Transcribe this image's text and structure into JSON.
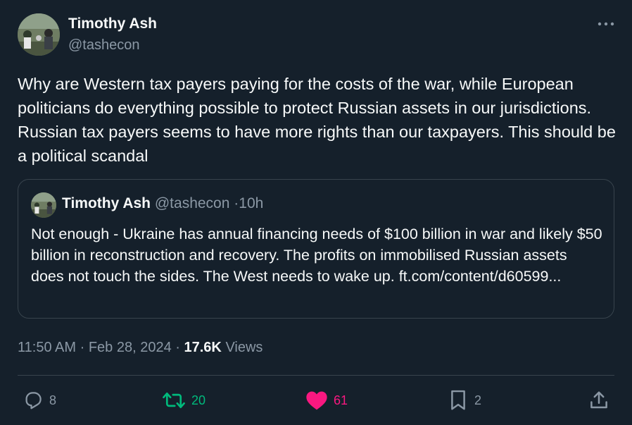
{
  "author": {
    "name": "Timothy Ash",
    "handle": "@tashecon"
  },
  "tweet": {
    "text": "Why are Western tax payers paying for the costs of the war, while European politicians do everything possible to protect Russian assets in our jurisdictions. Russian tax payers seems to have more rights than our taxpayers. This should be a political scandal"
  },
  "quote": {
    "name": "Timothy Ash",
    "handle": "@tashecon",
    "separator": "·",
    "time": "10h",
    "text": "Not enough - Ukraine has annual financing needs of $100 billion in war and likely $50 billion in reconstruction and recovery. The profits on immobilised Russian assets does not touch the sides. The West needs to wake up. ft.com/content/​d60599..."
  },
  "meta": {
    "time": "11:50 AM",
    "separator": "·",
    "date": "Feb 28, 2024",
    "views_count": "17.6K",
    "views_label": "Views"
  },
  "actions": {
    "replies": "8",
    "retweets": "20",
    "likes": "61",
    "bookmarks": "2"
  },
  "colors": {
    "background": "#15202b",
    "text": "#f7f9f9",
    "secondary": "#8b98a5",
    "retweet_active": "#00ba7c",
    "like_active": "#f91880",
    "border": "#38444d"
  }
}
